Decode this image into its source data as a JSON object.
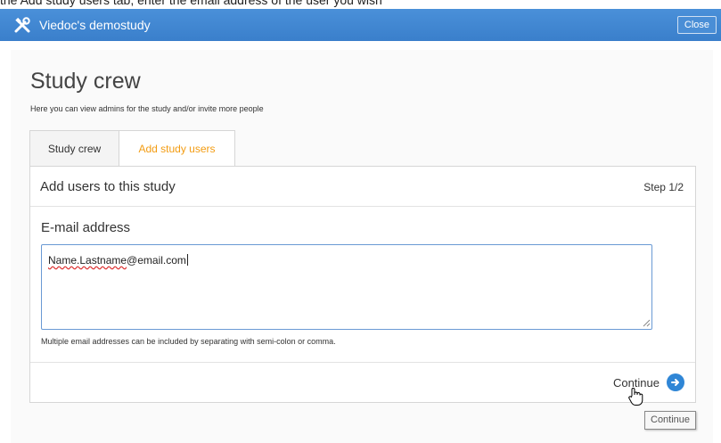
{
  "top_strip_text": "the Add study users tab, enter the email address of the user you wish",
  "header": {
    "app_title": "Viedoc's demostudy",
    "close_label": "Close",
    "icon": "tools-icon"
  },
  "page": {
    "title": "Study crew",
    "subtitle": "Here you can view admins for the study and/or invite more people"
  },
  "tabs": [
    {
      "label": "Study crew",
      "active": false
    },
    {
      "label": "Add study users",
      "active": true
    }
  ],
  "panel": {
    "title": "Add users to this study",
    "step": "Step 1/2",
    "email_label": "E-mail address",
    "email_value_name": "Name.Lastname",
    "email_value_domain": "@email.com",
    "hint": "Multiple email addresses can be included by separating with semi-colon or comma.",
    "continue_label": "Continue",
    "tooltip": "Continue"
  },
  "colors": {
    "header_blue": "#3a7fcb",
    "active_tab_orange": "#f39c12",
    "continue_icon_blue": "#2f86d6",
    "focus_border": "#6a9ad4"
  }
}
